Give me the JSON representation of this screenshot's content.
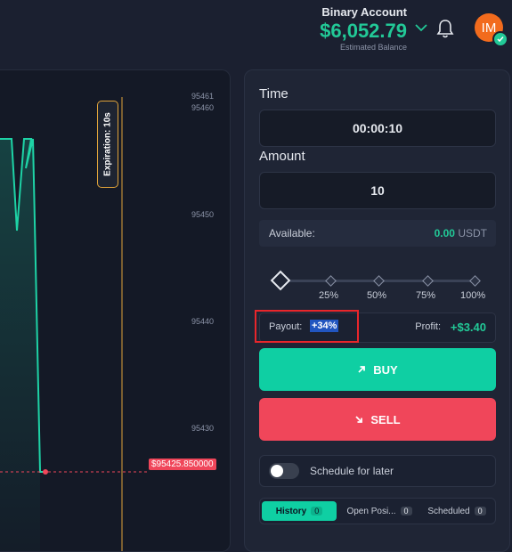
{
  "header": {
    "account_type": "Binary Account",
    "balance": "$6,052.79",
    "balance_sub": "Estimated Balance",
    "avatar_initials": "IM",
    "icons": [
      "chevron-down-icon",
      "bell-icon",
      "verified-check-icon"
    ]
  },
  "chart": {
    "y_ticks": [
      "95461",
      "95460",
      "95450",
      "95440",
      "95430"
    ],
    "current_price_tag": "$95425.850000",
    "expiration_label": "Expiration: 10s",
    "line_color": "#1ed3a6",
    "price_line_color": "#f0465a",
    "expiry_line_color": "#e0a33a"
  },
  "panel": {
    "time_label": "Time",
    "time_value": "00:00:10",
    "amount_label": "Amount",
    "amount_value": "10",
    "available_label": "Available:",
    "available_amount": "0.00",
    "available_currency": "USDT",
    "slider_stops": [
      "25%",
      "50%",
      "75%",
      "100%"
    ],
    "payout_label": "Payout:",
    "payout_value": "+34%",
    "profit_label": "Profit:",
    "profit_value": "+$3.40",
    "buy_label": "BUY",
    "sell_label": "SELL",
    "schedule_label": "Schedule for later",
    "tabs": [
      {
        "label": "History",
        "count": "0"
      },
      {
        "label": "Open Posi...",
        "count": "0"
      },
      {
        "label": "Scheduled",
        "count": "0"
      }
    ]
  },
  "colors": {
    "accent_green": "#0fcfa3",
    "sell_red": "#f0465a",
    "highlight_red": "#e8262b"
  }
}
